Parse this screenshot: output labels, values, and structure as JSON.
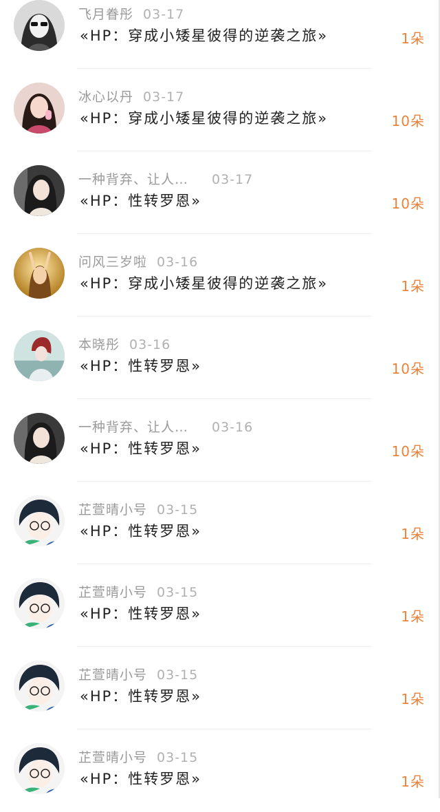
{
  "entries": [
    {
      "name": "飞月眷彤",
      "date": "03-17",
      "title": "«HP：穿成小矮星彼得的逆袭之旅»",
      "amount": "1朵",
      "avatar": "bw-girl-sunglasses"
    },
    {
      "name": "冰心以丹",
      "date": "03-17",
      "title": "«HP：穿成小矮星彼得的逆袭之旅»",
      "amount": "10朵",
      "avatar": "girl-icecream"
    },
    {
      "name": "一种背弃、让人…",
      "date": "03-17",
      "title": "«HP：性转罗恩»",
      "amount": "10朵",
      "avatar": "girl-peace-sign"
    },
    {
      "name": "问风三岁啦",
      "date": "03-16",
      "title": "«HP：穿成小矮星彼得的逆袭之旅»",
      "amount": "1朵",
      "avatar": "girl-golden-light"
    },
    {
      "name": "本晓彤",
      "date": "03-16",
      "title": "«HP：性转罗恩»",
      "amount": "10朵",
      "avatar": "anime-redhair"
    },
    {
      "name": "一种背弃、让人…",
      "date": "03-16",
      "title": "«HP：性转罗恩»",
      "amount": "10朵",
      "avatar": "girl-peace-sign"
    },
    {
      "name": "芷萱晴小号",
      "date": "03-15",
      "title": "«HP：性转罗恩»",
      "amount": "1朵",
      "avatar": "anime-glasses-boy"
    },
    {
      "name": "芷萱晴小号",
      "date": "03-15",
      "title": "«HP：性转罗恩»",
      "amount": "1朵",
      "avatar": "anime-glasses-boy"
    },
    {
      "name": "芷萱晴小号",
      "date": "03-15",
      "title": "«HP：性转罗恩»",
      "amount": "1朵",
      "avatar": "anime-glasses-boy"
    },
    {
      "name": "芷萱晴小号",
      "date": "03-15",
      "title": "«HP：性转罗恩»",
      "amount": "1朵",
      "avatar": "anime-glasses-boy"
    }
  ],
  "colors": {
    "amount": "#e8833a",
    "meta": "#9a9a9a",
    "title": "#222222"
  }
}
